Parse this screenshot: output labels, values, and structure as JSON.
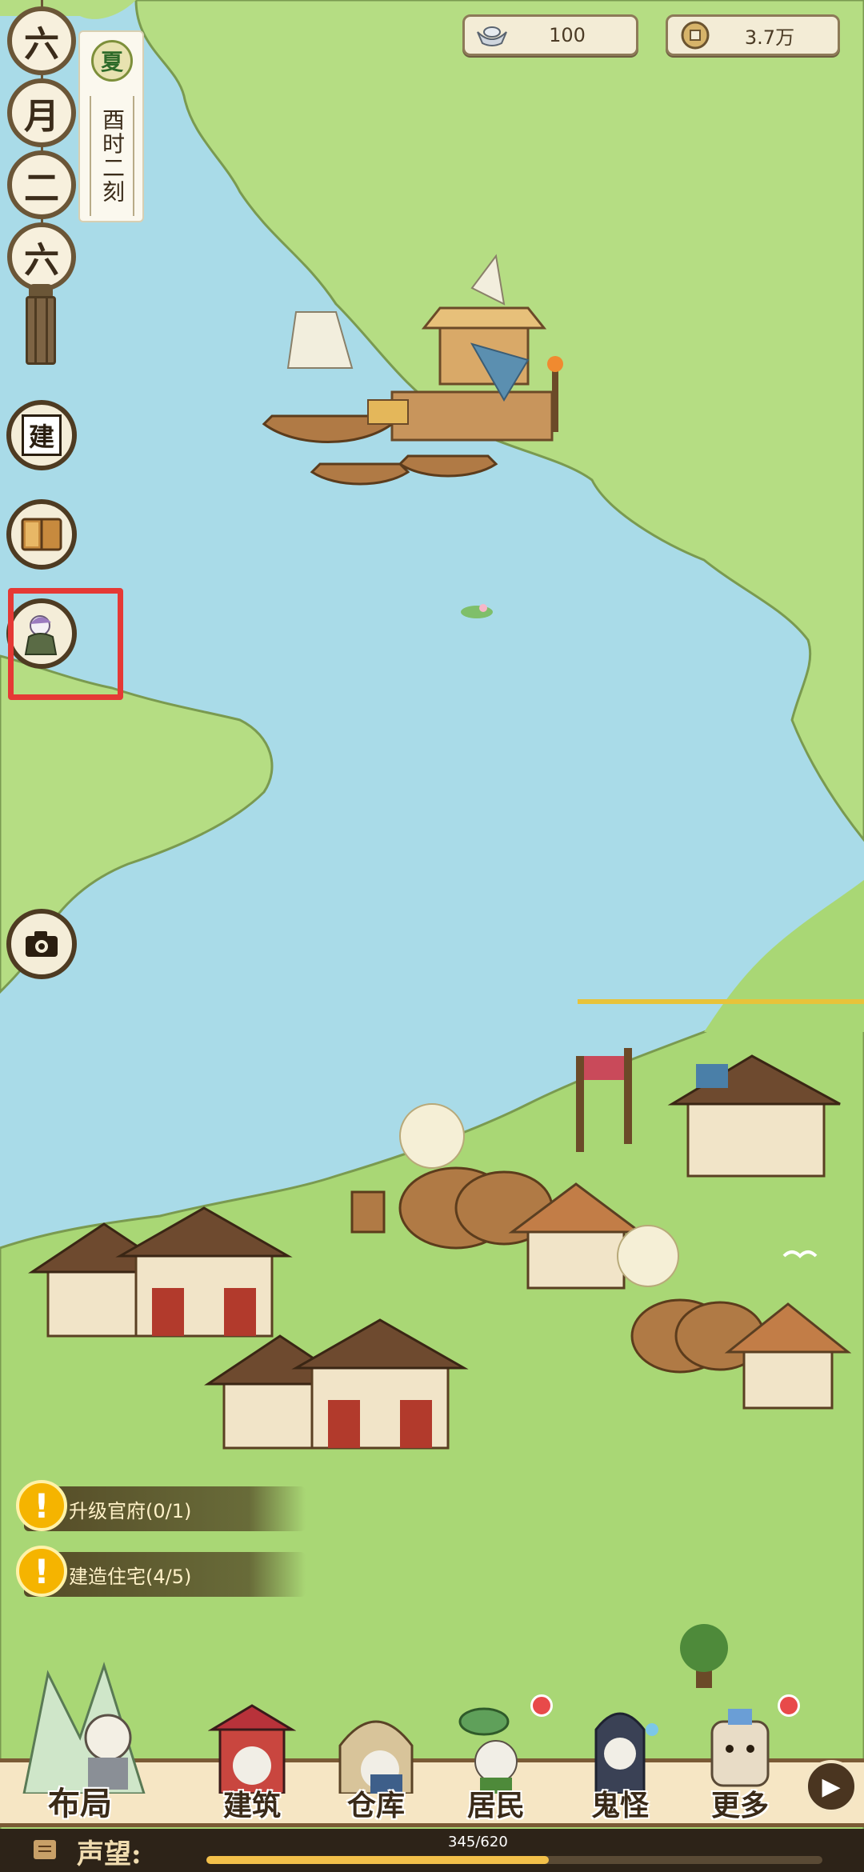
{
  "resources": {
    "silver": {
      "icon": "silver-ingot-icon",
      "value": "100"
    },
    "coins": {
      "icon": "copper-coin-icon",
      "value": "3.7万"
    }
  },
  "calendar": {
    "beads": [
      "六",
      "月",
      "二",
      "六"
    ],
    "season": "夏",
    "time": "酉时二刻"
  },
  "side_buttons": {
    "build": "建",
    "book": "book-icon",
    "ghost": "ghost-avatar-icon",
    "camera": "camera-icon"
  },
  "quests": [
    {
      "text": "升级官府(0/1)"
    },
    {
      "text": "建造住宅(4/5)"
    }
  ],
  "bottom_nav": [
    {
      "label": "布局",
      "badge": false
    },
    {
      "label": "建筑",
      "badge": false
    },
    {
      "label": "仓库",
      "badge": false
    },
    {
      "label": "居民",
      "badge": true
    },
    {
      "label": "鬼怪",
      "badge": false
    },
    {
      "label": "更多",
      "badge": true
    }
  ],
  "reputation": {
    "label": "声望:",
    "progress_text": "345/620",
    "current": 345,
    "max": 620
  },
  "colors": {
    "water": "#a9dbe8",
    "grass": "#a9d775",
    "highlight": "#e53935"
  }
}
